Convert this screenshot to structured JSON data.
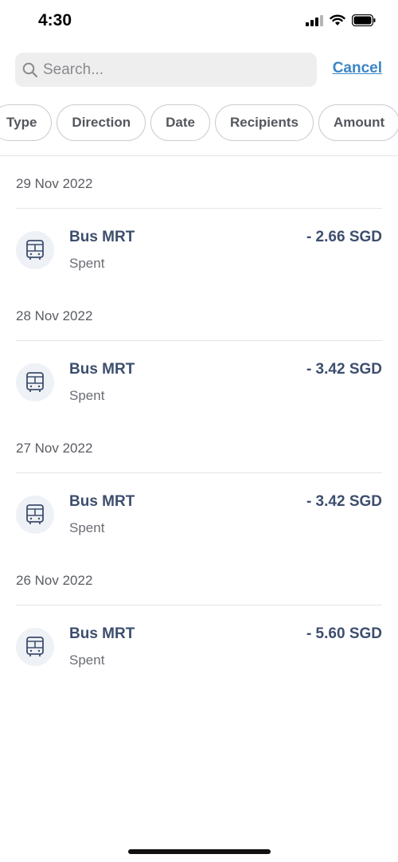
{
  "status_bar": {
    "time": "4:30",
    "icons": [
      "signal-icon",
      "wifi-icon",
      "battery-icon"
    ]
  },
  "search": {
    "placeholder": "Search...",
    "value": "",
    "cancel_label": "Cancel"
  },
  "filters": [
    "Type",
    "Direction",
    "Date",
    "Recipients",
    "Amount"
  ],
  "groups": [
    {
      "date": "29 Nov 2022",
      "transactions": [
        {
          "title": "Bus MRT",
          "subtitle": "Spent",
          "amount": "- 2.66 SGD",
          "icon": "bus-icon"
        }
      ]
    },
    {
      "date": "28 Nov 2022",
      "transactions": [
        {
          "title": "Bus MRT",
          "subtitle": "Spent",
          "amount": "- 3.42 SGD",
          "icon": "bus-icon"
        }
      ]
    },
    {
      "date": "27 Nov 2022",
      "transactions": [
        {
          "title": "Bus MRT",
          "subtitle": "Spent",
          "amount": "- 3.42 SGD",
          "icon": "bus-icon"
        }
      ]
    },
    {
      "date": "26 Nov 2022",
      "transactions": [
        {
          "title": "Bus MRT",
          "subtitle": "Spent",
          "amount": "- 5.60 SGD",
          "icon": "bus-icon"
        }
      ]
    }
  ],
  "colors": {
    "accent": "#3b86c5",
    "title": "#3d4e6e",
    "icon_bg": "#eef1f5"
  }
}
